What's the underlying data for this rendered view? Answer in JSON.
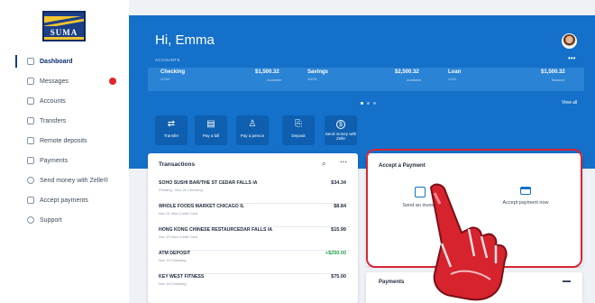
{
  "sidebar": {
    "logo_text": "SUMA",
    "items": [
      {
        "label": "Dashboard",
        "icon": "dashboard-icon",
        "active": true
      },
      {
        "label": "Messages",
        "icon": "mail-icon",
        "badge": true
      },
      {
        "label": "Accounts",
        "icon": "accounts-icon"
      },
      {
        "label": "Transfers",
        "icon": "transfer-icon"
      },
      {
        "label": "Remote deposits",
        "icon": "deposit-icon"
      },
      {
        "label": "Payments",
        "icon": "payments-icon"
      },
      {
        "label": "Send money with Zelle®",
        "icon": "zelle-icon"
      },
      {
        "label": "Accept payments",
        "icon": "card-icon"
      },
      {
        "label": "Support",
        "icon": "support-icon"
      }
    ]
  },
  "header": {
    "greeting": "Hi, Emma",
    "accounts_label": "ACCOUNTS",
    "more": "•••",
    "view_all": "View all"
  },
  "accounts": [
    {
      "name": "Checking",
      "sub": "•1234",
      "amount": "$1,500.32",
      "amount_sub": "Available"
    },
    {
      "name": "Savings",
      "sub": "•5678",
      "amount": "$2,500.32",
      "amount_sub": "Available"
    },
    {
      "name": "Loan",
      "sub": "•1111",
      "amount": "$1,500.32",
      "amount_sub": "Balance"
    }
  ],
  "quick_actions": [
    {
      "label": "Transfer",
      "icon": "transfer-icon"
    },
    {
      "label": "Pay a bill",
      "icon": "bill-icon"
    },
    {
      "label": "Pay a person",
      "icon": "person-icon"
    },
    {
      "label": "Deposit",
      "icon": "deposit-icon"
    },
    {
      "label": "Send money with Zelle",
      "icon": "zelle-icon"
    }
  ],
  "transactions": {
    "title": "Transactions",
    "rows": [
      {
        "desc": "SOHO SUSHI BAR/THE ST CEDAR FALLS IA",
        "sub": "Pending · Nov 21 Checking",
        "amount": "$34.34",
        "positive": false
      },
      {
        "desc": "WHOLE FOODS MARKET CHICAGO IL",
        "sub": "Nov 21 Visa Credit Card",
        "amount": "$8.84",
        "positive": false
      },
      {
        "desc": "HONG KONG CHINESE RESTAURCEDAR FALLS IA",
        "sub": "Nov 20 Visa Credit Card",
        "amount": "$15.99",
        "positive": false
      },
      {
        "desc": "ATM DEPOSIT",
        "sub": "Nov 19 Checking",
        "amount": "+$250.00",
        "positive": true
      },
      {
        "desc": "KEY WEST FITNESS",
        "sub": "Nov 18 Checking",
        "amount": "$75.00",
        "positive": false
      }
    ]
  },
  "accept_payment": {
    "title": "Accept a Payment",
    "options": [
      {
        "label": "Send an invoice",
        "icon": "invoice-icon"
      },
      {
        "label": "Accept payment now",
        "icon": "card-icon"
      }
    ]
  },
  "payments": {
    "title": "Payments"
  },
  "colors": {
    "brand_blue": "#1470c8",
    "highlight_red": "#d62535",
    "positive_green": "#1f9d4c"
  }
}
